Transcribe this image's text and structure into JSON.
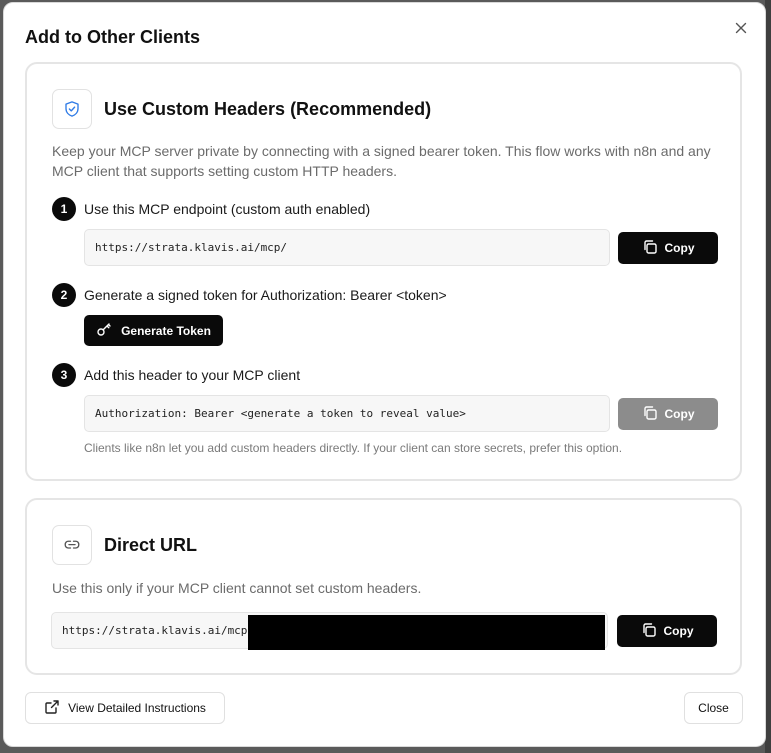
{
  "dialog": {
    "title": "Add to Other Clients",
    "close_icon": "close-icon"
  },
  "custom_headers": {
    "icon": "shield-check-icon",
    "title": "Use Custom Headers (Recommended)",
    "description": "Keep your MCP server private by connecting with a signed bearer token. This flow works with n8n and any MCP client that supports setting custom HTTP headers.",
    "steps": [
      {
        "number": "1",
        "label": "Use this MCP endpoint (custom auth enabled)"
      },
      {
        "number": "2",
        "label": "Generate a signed token for Authorization: Bearer <token>"
      },
      {
        "number": "3",
        "label": "Add this header to your MCP client"
      }
    ],
    "endpoint_value": "https://strata.klavis.ai/mcp/",
    "copy_label": "Copy",
    "generate_label": "Generate Token",
    "header_value": "Authorization: Bearer <generate a token to reveal value>",
    "hint": "Clients like n8n let you add custom headers directly. If your client can store secrets, prefer this option."
  },
  "direct_url": {
    "icon": "link-icon",
    "title": "Direct URL",
    "description": "Use this only if your MCP client cannot set custom headers.",
    "url_value": "https://strata.klavis.ai/mcp",
    "copy_label": "Copy"
  },
  "footer": {
    "instructions_label": "View Detailed Instructions",
    "close_label": "Close"
  },
  "colors": {
    "accent_blue": "#2f7be6",
    "button_black": "#0a0a0a",
    "button_disabled": "#8c8c8c"
  }
}
